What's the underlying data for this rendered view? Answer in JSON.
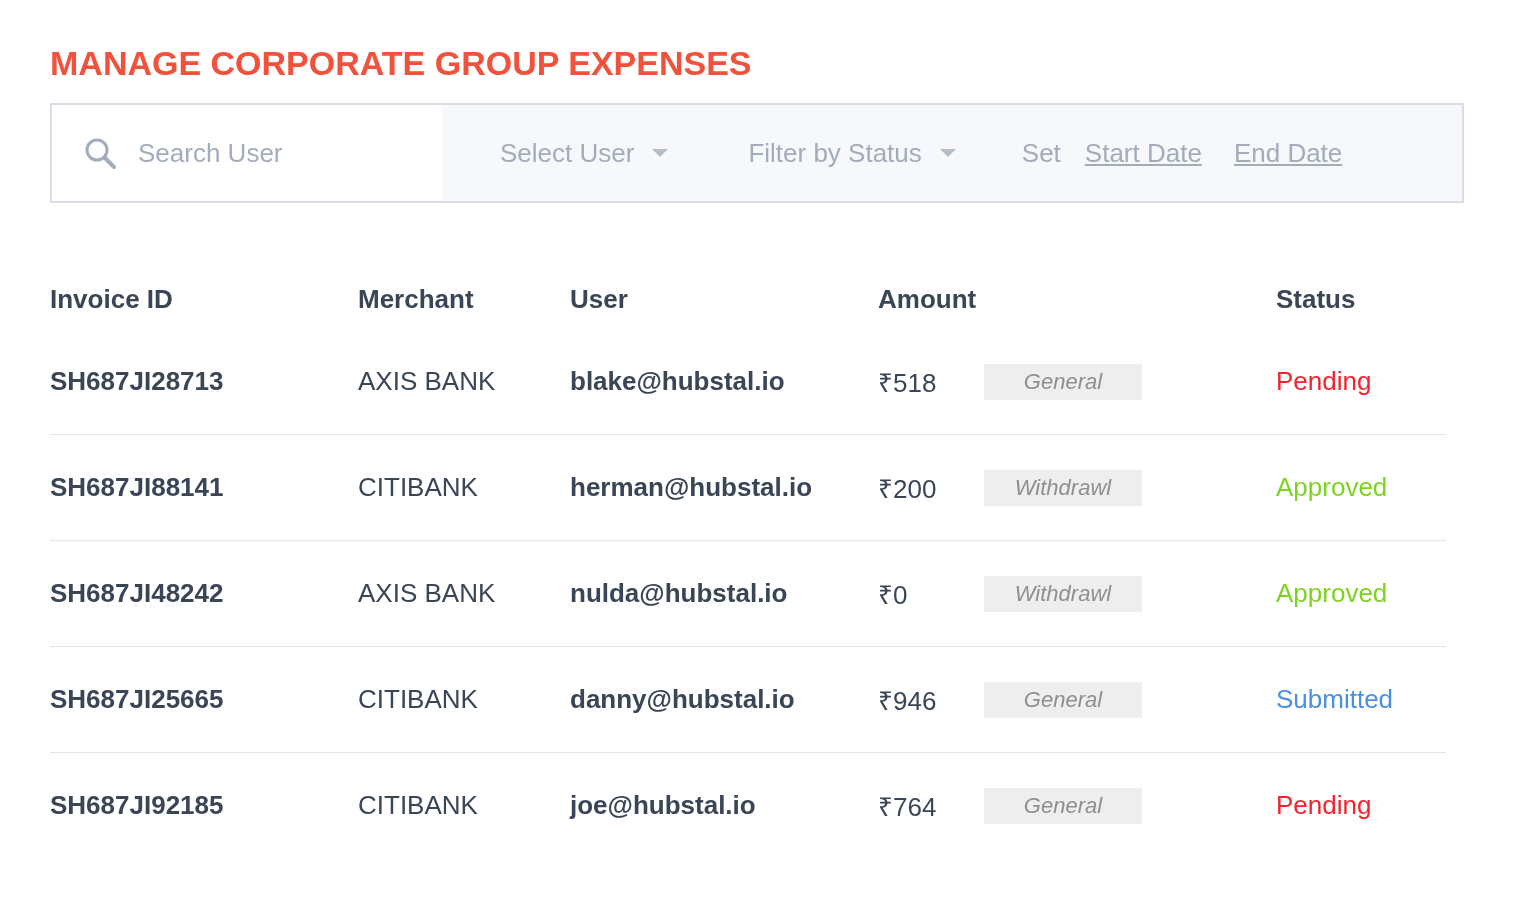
{
  "title": "MANAGE CORPORATE GROUP EXPENSES",
  "filters": {
    "search": {
      "placeholder": "Search User"
    },
    "select_user": "Select User",
    "filter_status": "Filter by Status",
    "date_label": "Set",
    "start_date": "Start Date",
    "end_date": "End Date"
  },
  "table": {
    "columns": [
      "Invoice ID",
      "Merchant",
      "User",
      "Amount",
      "Status"
    ],
    "rows": [
      {
        "invoice_id": "SH687JI28713",
        "merchant": "AXIS BANK",
        "user": "blake@hubstal.io",
        "amount": "₹518",
        "tag": "General",
        "status": "Pending",
        "color": "#f5222d"
      },
      {
        "invoice_id": "SH687JI88141",
        "merchant": "CITIBANK",
        "user": "herman@hubstal.io",
        "amount": "₹200",
        "tag": "Withdrawl",
        "status": "Approved",
        "color": "#7ed321"
      },
      {
        "invoice_id": "SH687JI48242",
        "merchant": "AXIS BANK",
        "user": "nulda@hubstal.io",
        "amount": "₹0",
        "tag": "Withdrawl",
        "status": "Approved",
        "color": "#7ed321"
      },
      {
        "invoice_id": "SH687JI25665",
        "merchant": "CITIBANK",
        "user": "danny@hubstal.io",
        "amount": "₹946",
        "tag": "General",
        "status": "Submitted",
        "color": "#4a90e2"
      },
      {
        "invoice_id": "SH687JI92185",
        "merchant": "CITIBANK",
        "user": "joe@hubstal.io",
        "amount": "₹764",
        "tag": "General",
        "status": "Pending",
        "color": "#f5222d"
      }
    ]
  }
}
